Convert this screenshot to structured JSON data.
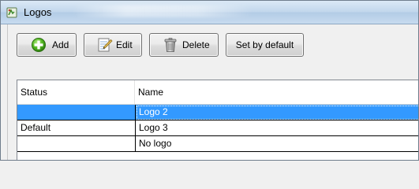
{
  "window": {
    "title": "Logos",
    "icon": "app-icon"
  },
  "toolbar": {
    "add": {
      "label": "Add",
      "icon": "add-green-plus-icon"
    },
    "edit": {
      "label": "Edit",
      "icon": "notepad-pencil-icon"
    },
    "delete": {
      "label": "Delete",
      "icon": "trash-can-icon"
    },
    "set_default": {
      "label": "Set by default"
    }
  },
  "table": {
    "columns": [
      "Status",
      "Name"
    ],
    "rows": [
      {
        "status": "",
        "name": "Logo 2",
        "selected": true
      },
      {
        "status": "Default",
        "name": "Logo 3",
        "selected": false
      },
      {
        "status": "",
        "name": "No logo",
        "selected": false
      }
    ]
  },
  "colors": {
    "selection": "#3399ff",
    "titlebar": "#c2d7ec"
  }
}
